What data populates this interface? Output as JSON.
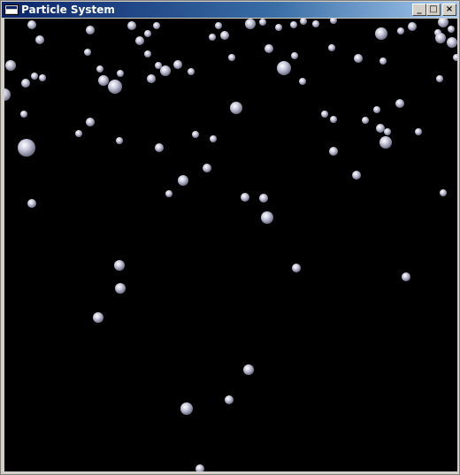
{
  "window": {
    "title": "Particle System",
    "icon": "window-app-icon",
    "controls": {
      "minimize": {
        "icon": "minimize-icon",
        "glyph": "_"
      },
      "maximize": {
        "icon": "maximize-icon",
        "glyph": "□"
      },
      "close": {
        "icon": "close-icon",
        "glyph": "×"
      }
    }
  },
  "colors": {
    "titlebar_start": "#0a246a",
    "titlebar_end": "#a6caf0",
    "title_text": "#ffffff",
    "canvas_background": "#000000",
    "particle_highlight": "#ffffff",
    "particle_mid": "#c9c9dc",
    "particle_shade": "#6f6f88"
  }
}
